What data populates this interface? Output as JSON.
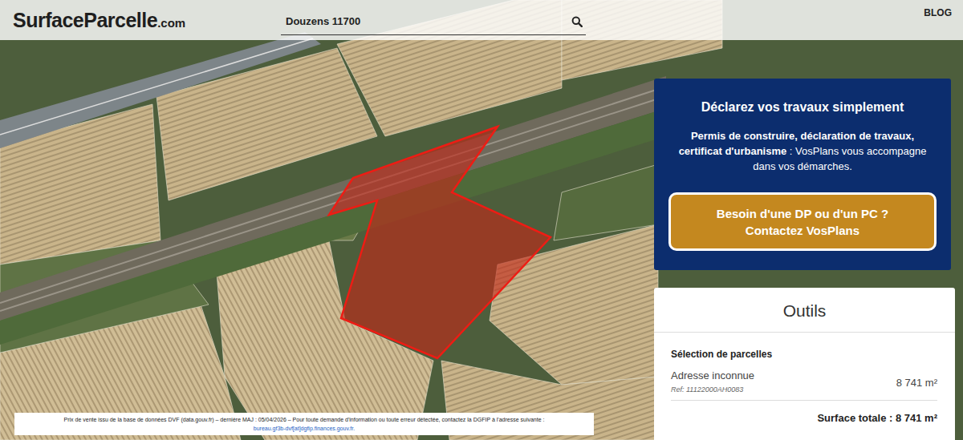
{
  "header": {
    "logo": {
      "name": "SurfaceParcelle",
      "suffix": ".com"
    },
    "search": {
      "value": "Douzens 11700"
    },
    "nav": [
      "BLOG"
    ]
  },
  "map": {
    "parcels": [
      {
        "selected": true
      }
    ]
  },
  "promo": {
    "title": "Déclarez vos travaux simplement",
    "text_bold": "Permis de construire, déclaration de travaux, certificat d'urbanisme",
    "text": " : VosPlans vous accompagne dans vos démarches.",
    "button": [
      "Besoin d'une DP ou d'un PC ?",
      "Contactez VosPlans"
    ]
  },
  "tools": {
    "title": "Outils",
    "section": "Sélection de parcelles",
    "parcels": [
      {
        "address": "Adresse inconnue",
        "ref": "Ref: 11122000AH0083",
        "area": "8 741 m²"
      }
    ],
    "total": "Surface totale : 8 741 m²"
  },
  "footer": {
    "note": "Prix de vente issu de la base de données DVF (data.gouv.fr) – dernière MAJ : 05/04/2026 – Pour toute demande d'information ou toute erreur détectée, contactez la DGFIP à l'adresse suivante :",
    "link": "bureau.gf3b-dvf[at]dgfip.finances.gouv.fr."
  }
}
